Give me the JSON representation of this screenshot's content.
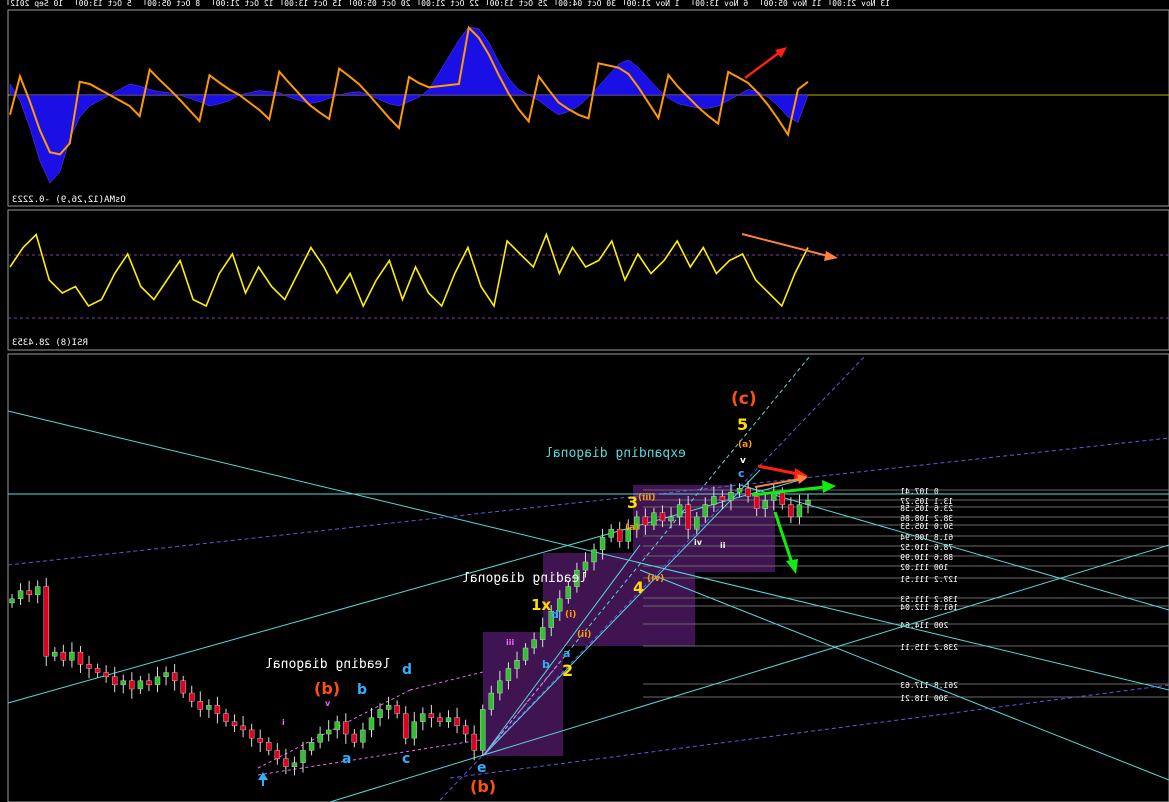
{
  "colors": {
    "background": "#000000",
    "panel_border": "#9a9a9a",
    "osma_fill": "#1a10e6",
    "osma_line": "#ff9900",
    "rsi_line": "#ffee00",
    "candle_up": "#30c030",
    "candle_down": "#e00020",
    "trend_cyan": "#5ad7d7",
    "trend_blue_dashed": "#5a5ae0",
    "wave_box": "#4a1860",
    "fib_line": "#6a6a6a",
    "arrow_red": "#ff2010",
    "arrow_green": "#10ee10",
    "arrow_orange": "#ff8040",
    "wave_orange": "#ff5010",
    "wave_yellow": "#ffdd00",
    "wave_cyan": "#30b0ff"
  },
  "time_axis": {
    "labels": [
      "10 Sep 2012",
      "5 Oct 13:00",
      "8 Oct 05:00",
      "12 Oct 21:00",
      "15 Oct 13:00",
      "20 Oct 05:00",
      "22 Oct 21:00",
      "25 Oct 13:00",
      "30 Oct 04:00",
      "1 Nov 21:00",
      "6 Nov 13:00",
      "11 Nov 05:00",
      "13 Nov 21:00"
    ]
  },
  "indicators": {
    "osma_label": "OsMA(12,26,9) -0.2223",
    "rsi_label": "RSI(8) 28.4353"
  },
  "wave_labels": {
    "c_big": "(c)",
    "five": "5",
    "a_small": "(a)",
    "v_small": "v",
    "c_cyan": "c",
    "three": "3",
    "four": "4",
    "iii": "(iii)",
    "a_iii": "(a)",
    "iv": "(iv)",
    "i_paren": "(i)",
    "ii_paren": "(ii)",
    "x1": "1x",
    "d_cyan": "d",
    "b_cyan": "b",
    "a_cyan": "a",
    "two": "2",
    "b_small": "b",
    "b_paren_orange": "(b)",
    "b_blue": "b",
    "d_blue": "d",
    "a_blue": "a",
    "c_blue": "c",
    "e_blue": "e",
    "b_orange_bottom": "(b)",
    "iii_roman": "iii",
    "iv_roman": "iv",
    "ii_roman": "ii",
    "i_roman": "i",
    "v_roman": "v"
  },
  "pattern_labels": {
    "expanding": "expanding diagonal",
    "leading_mid": "leading diagonal",
    "leading_left": "leading diagonal"
  },
  "fib_levels": [
    {
      "label": "0 107.41"
    },
    {
      "label": "13.1 105.27"
    },
    {
      "label": "23.6 105.58"
    },
    {
      "label": "38.2 108.86"
    },
    {
      "label": "50.0 105.53"
    },
    {
      "label": "61.8 108.94"
    },
    {
      "label": "78.6 110.52"
    },
    {
      "label": "88.6 110.99"
    },
    {
      "label": "100 111.02"
    },
    {
      "label": "127.2 111.51"
    },
    {
      "label": "138.2 111.53"
    },
    {
      "label": "161.8 112.04"
    },
    {
      "label": "200 114.64"
    },
    {
      "label": "238.2 115.11"
    },
    {
      "label": "261.8 117.63"
    },
    {
      "label": "300 118.21"
    }
  ],
  "chart_data": {
    "type": "candlestick",
    "osma": [
      10,
      -5,
      -30,
      -60,
      -80,
      -70,
      -40,
      -20,
      -10,
      -5,
      0,
      5,
      10,
      8,
      5,
      3,
      2,
      0,
      -3,
      -6,
      -10,
      -8,
      -5,
      0,
      2,
      4,
      3,
      2,
      -2,
      -5,
      -8,
      -6,
      -3,
      0,
      2,
      3,
      0,
      -4,
      -8,
      -10,
      -6,
      -2,
      5,
      20,
      35,
      50,
      62,
      60,
      48,
      30,
      15,
      5,
      0,
      -5,
      -12,
      -18,
      -15,
      -10,
      -2,
      8,
      18,
      28,
      32,
      25,
      15,
      5,
      -3,
      -8,
      -10,
      -12,
      -12,
      -10,
      -5,
      0,
      5,
      3,
      -2,
      -10,
      -20,
      -25,
      0
    ],
    "rsi": [
      60,
      75,
      85,
      50,
      40,
      45,
      30,
      35,
      55,
      70,
      45,
      35,
      50,
      65,
      35,
      30,
      55,
      70,
      40,
      60,
      45,
      35,
      55,
      75,
      60,
      40,
      55,
      30,
      50,
      65,
      35,
      60,
      40,
      30,
      55,
      75,
      45,
      30,
      80,
      70,
      60,
      85,
      55,
      75,
      60,
      65,
      80,
      50,
      70,
      55,
      65,
      80,
      60,
      75,
      55,
      65,
      70,
      50,
      40,
      30,
      55,
      75
    ],
    "candles": [
      108.6,
      108.8,
      108.7,
      108.9,
      107.2,
      107.3,
      107.1,
      107.3,
      107.0,
      106.9,
      106.8,
      106.7,
      106.5,
      106.6,
      106.4,
      106.6,
      106.5,
      106.7,
      106.8,
      106.6,
      106.3,
      106.1,
      105.9,
      106.0,
      105.8,
      105.6,
      105.5,
      105.4,
      105.2,
      105.1,
      104.9,
      104.7,
      104.5,
      104.6,
      104.9,
      105.1,
      105.3,
      105.4,
      105.6,
      105.3,
      105.1,
      105.4,
      105.7,
      105.9,
      106.0,
      105.8,
      105.2,
      105.6,
      105.8,
      105.7,
      105.6,
      105.7,
      105.5,
      105.3,
      104.9,
      105.9,
      106.3,
      106.6,
      106.9,
      107.1,
      107.4,
      107.6,
      107.9,
      108.3,
      108.6,
      108.9,
      109.3,
      109.5,
      109.8,
      110.1,
      110.3,
      110.0,
      110.3,
      110.6,
      110.4,
      110.7,
      110.5,
      110.6,
      110.9,
      110.3,
      110.6,
      110.9,
      111.1,
      111.0,
      111.2,
      111.3,
      111.1,
      110.8,
      111.0,
      111.2,
      110.9,
      110.6,
      110.9,
      111.0
    ]
  }
}
